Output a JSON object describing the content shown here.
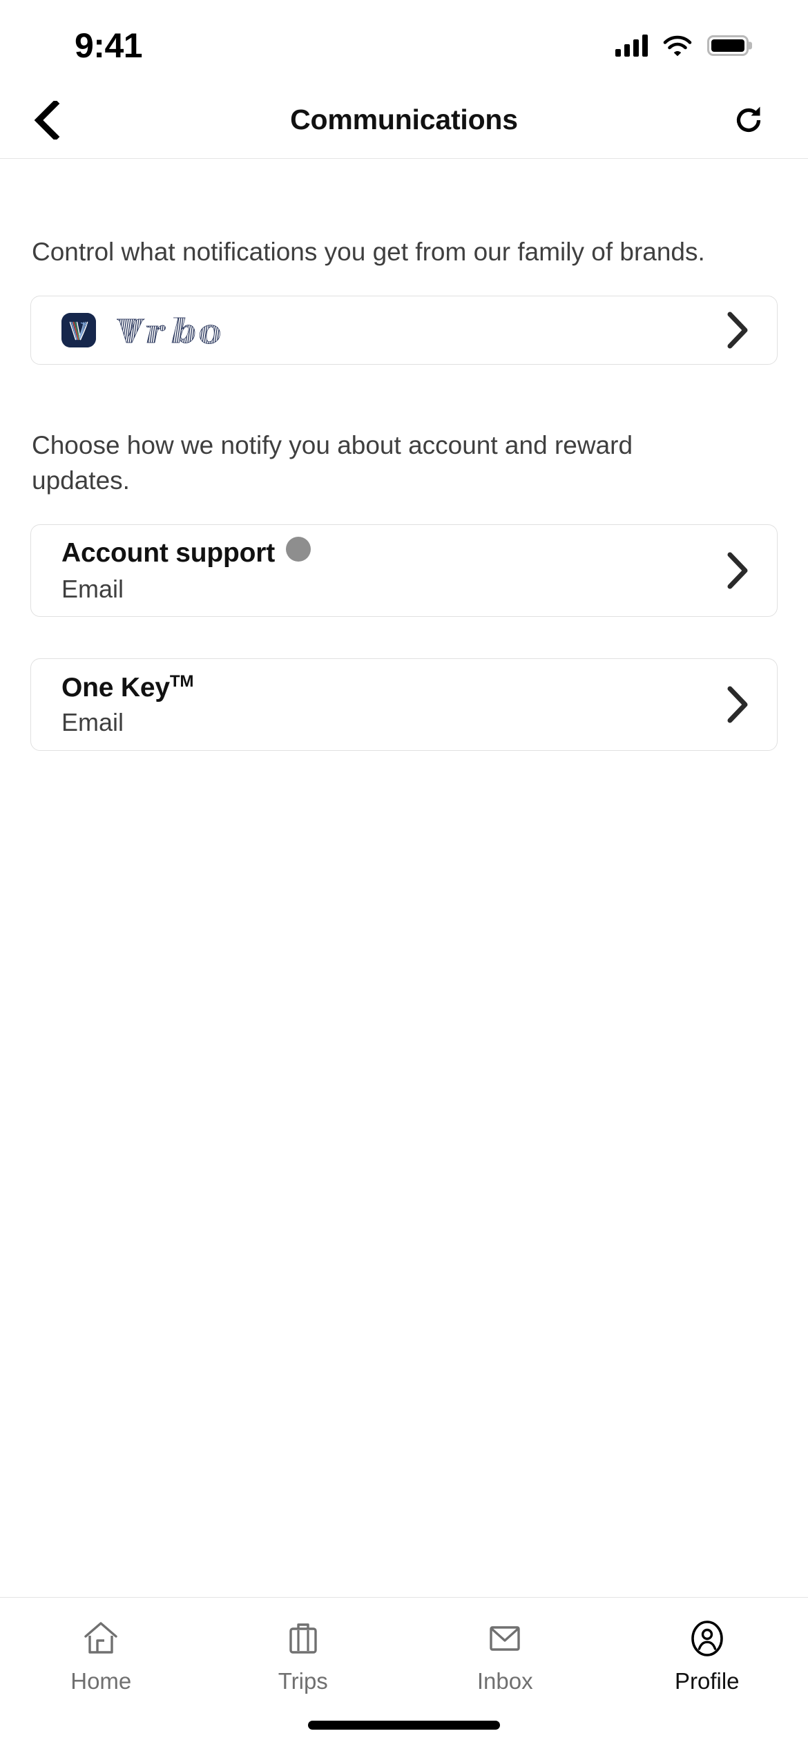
{
  "status_bar": {
    "time": "9:41",
    "cellular_icon": "cellular-signal-icon",
    "wifi_icon": "wifi-icon",
    "battery_icon": "battery-full-icon"
  },
  "header": {
    "back_icon": "chevron-left-icon",
    "title": "Communications",
    "refresh_icon": "refresh-icon"
  },
  "sections": [
    {
      "description": "Control what notifications you get from our family of brands.",
      "cards": [
        {
          "kind": "brand",
          "brand_name": "Vrbo",
          "logo_icon": "vrbo-logo-icon",
          "chevron_icon": "chevron-right-icon"
        }
      ]
    },
    {
      "description": "Choose how we notify you about account and reward updates.",
      "cards": [
        {
          "kind": "preference",
          "title": "Account support",
          "trademark": "",
          "badge": true,
          "badge_color": "#8e8e8e",
          "subtitle": "Email",
          "chevron_icon": "chevron-right-icon"
        },
        {
          "kind": "preference",
          "title": "One Key",
          "trademark": "TM",
          "badge": false,
          "subtitle": "Email",
          "chevron_icon": "chevron-right-icon"
        }
      ]
    }
  ],
  "tabbar": {
    "items": [
      {
        "label": "Home",
        "icon": "home-icon",
        "active": false
      },
      {
        "label": "Trips",
        "icon": "suitcase-icon",
        "active": false
      },
      {
        "label": "Inbox",
        "icon": "envelope-icon",
        "active": false
      },
      {
        "label": "Profile",
        "icon": "person-circle-icon",
        "active": true
      }
    ]
  },
  "colors": {
    "brand_navy": "#16274c",
    "text_primary": "#111111",
    "text_secondary": "#3f3f3f",
    "tab_inactive": "#707070",
    "card_border": "#e0e0e0"
  }
}
